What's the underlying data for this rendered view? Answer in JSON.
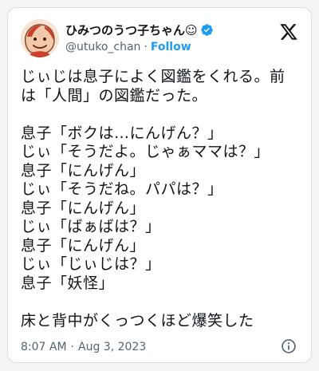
{
  "author": {
    "display_name": "ひみつのうつ子ちゃん☺",
    "handle": "@utuko_chan",
    "separator": "·",
    "follow_label": "Follow",
    "verified_icon": "verified-badge-icon",
    "avatar": "avatar-illustration"
  },
  "platform": {
    "logo_icon": "x-logo-icon"
  },
  "tweet": {
    "lines": [
      "じぃじは息子によく図鑑をくれる。前",
      "は「人間」の図鑑だった。",
      "",
      "息子「ボクは…にんげん？」",
      "じぃ「そうだよ。じゃぁママは？」",
      "息子「にんげん」",
      "じぃ「そうだね。パパは？」",
      "息子「にんげん」",
      "じぃ「ばぁばは？」",
      "息子「にんげん」",
      "じぃ「じぃじは？」",
      "息子「妖怪」",
      "",
      "床と背中がくっつくほど爆笑した"
    ]
  },
  "meta": {
    "time": "8:07 AM",
    "separator": "·",
    "date": "Aug 3, 2023",
    "info_icon": "info-icon"
  },
  "colors": {
    "text": "#0f1419",
    "secondary": "#536471",
    "accent": "#1d9bf0"
  }
}
